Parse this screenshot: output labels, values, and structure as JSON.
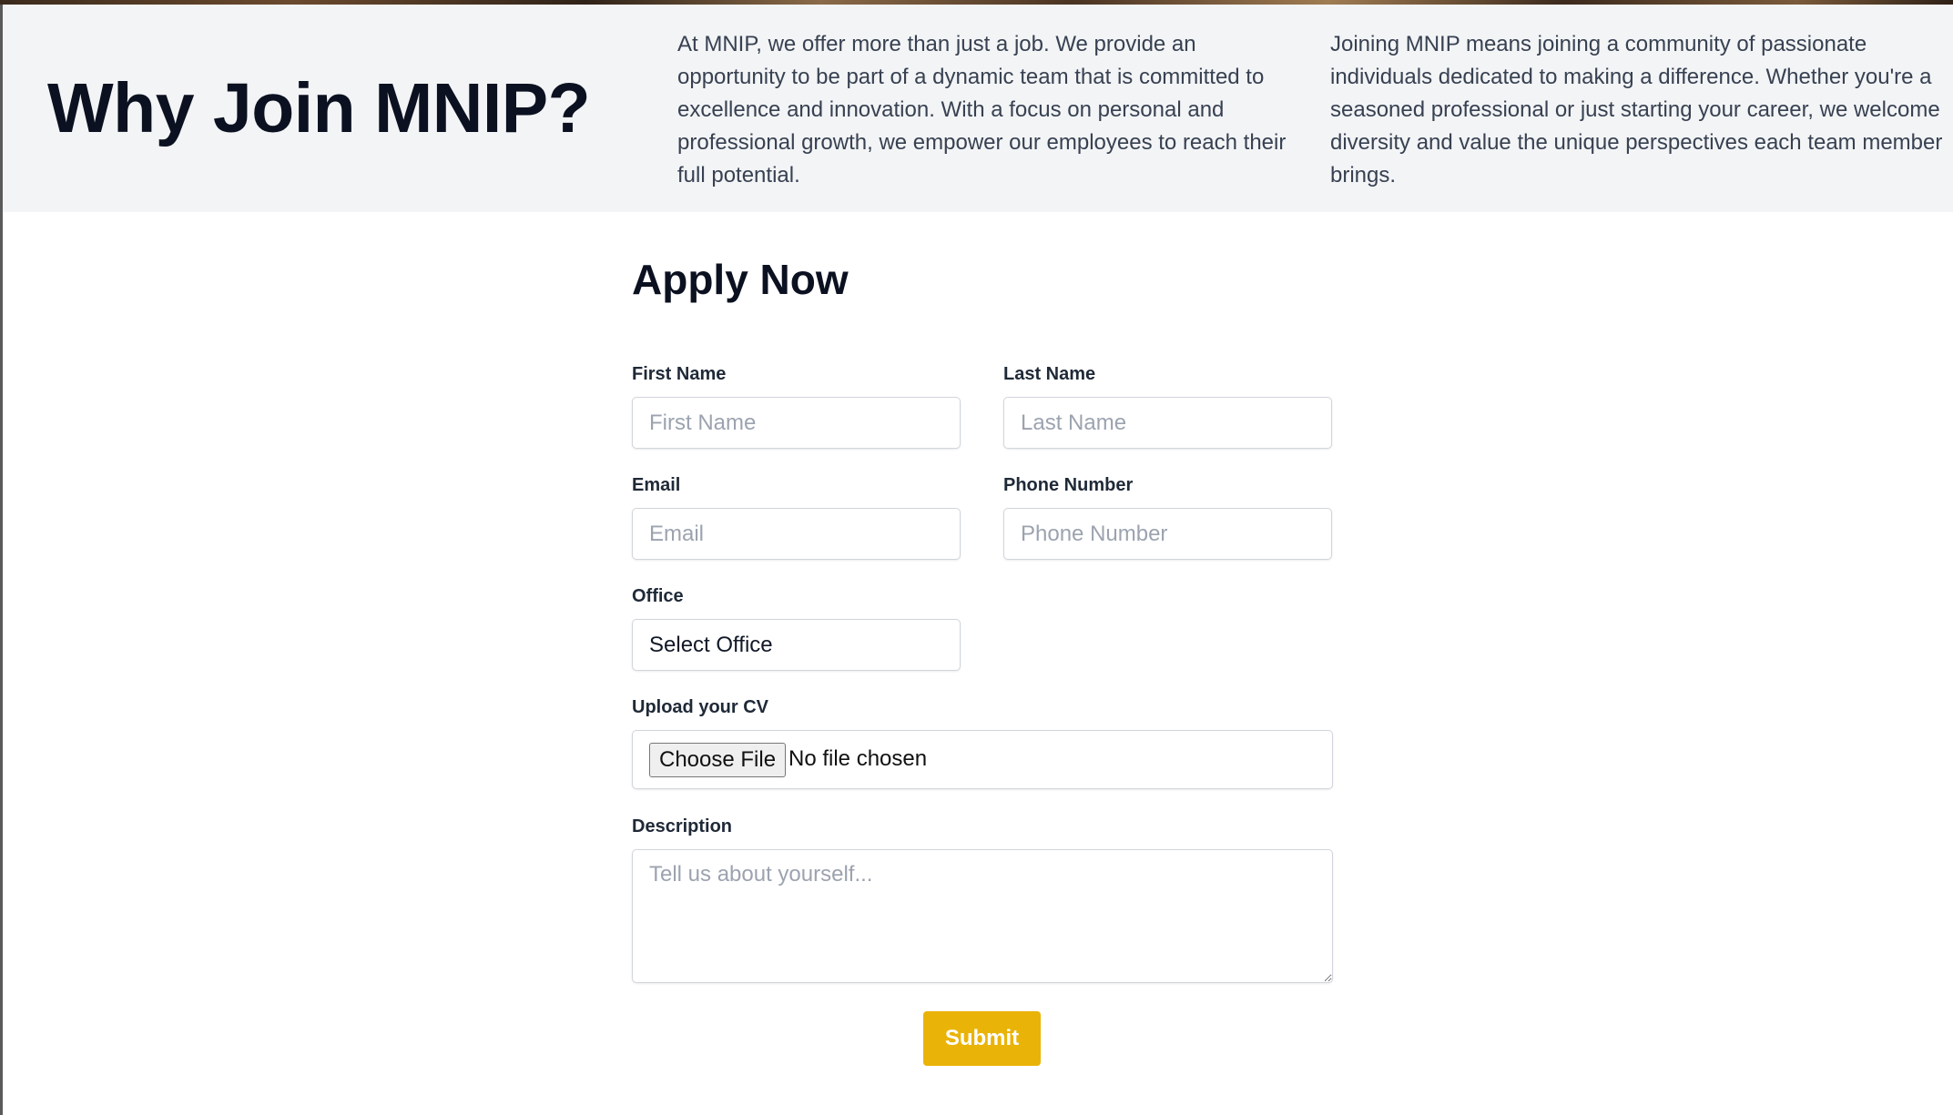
{
  "why": {
    "title": "Why Join MNIP?",
    "paragraph_1": "At MNIP, we offer more than just a job. We provide an opportunity to be part of a dynamic team that is committed to excellence and innovation. With a focus on personal and professional growth, we empower our employees to reach their full potential.",
    "paragraph_2": "Joining MNIP means joining a community of passionate individuals dedicated to making a difference. Whether you're a seasoned professional or just starting your career, we welcome diversity and value the unique perspectives each team member brings."
  },
  "form": {
    "title": "Apply Now",
    "first_name": {
      "label": "First Name",
      "placeholder": "First Name",
      "value": ""
    },
    "last_name": {
      "label": "Last Name",
      "placeholder": "Last Name",
      "value": ""
    },
    "email": {
      "label": "Email",
      "placeholder": "Email",
      "value": ""
    },
    "phone": {
      "label": "Phone Number",
      "placeholder": "Phone Number",
      "value": ""
    },
    "office": {
      "label": "Office",
      "selected": "Select Office"
    },
    "cv": {
      "label": "Upload your CV",
      "button_label": "Choose File",
      "status": "No file chosen"
    },
    "description": {
      "label": "Description",
      "placeholder": "Tell us about yourself...",
      "value": ""
    },
    "submit_label": "Submit"
  },
  "colors": {
    "accent": "#eab308",
    "header_background": "#f3f4f6",
    "heading": "#0b1120",
    "body_text": "#374151",
    "placeholder": "#9ca3af"
  }
}
